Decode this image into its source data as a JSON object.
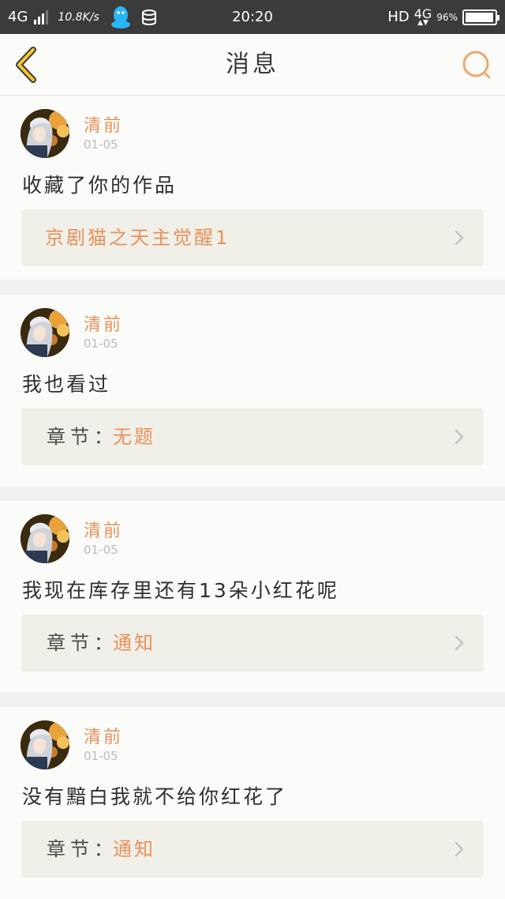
{
  "status_bar": {
    "network": "4G",
    "speed": "10.8K/s",
    "time": "20:20",
    "hd": "HD",
    "network_right": "4G",
    "battery_percent": "96%",
    "battery_level": 0.96,
    "icons": [
      "signal-icon",
      "qq-icon",
      "database-icon",
      "battery-icon"
    ]
  },
  "header": {
    "title": "消息",
    "back_icon": "chevron-left-icon",
    "search_icon": "search-icon",
    "accent_color": "#f0a86c"
  },
  "messages": [
    {
      "user": "清前",
      "date": "01-05",
      "text": "收藏了你的作品",
      "ref_label": "",
      "ref_value": "京剧猫之天主觉醒1"
    },
    {
      "user": "清前",
      "date": "01-05",
      "text": "我也看过",
      "ref_label": "章节：",
      "ref_value": "无题"
    },
    {
      "user": "清前",
      "date": "01-05",
      "text": "我现在库存里还有13朵小红花呢",
      "ref_label": "章节：",
      "ref_value": "通知"
    },
    {
      "user": "清前",
      "date": "01-05",
      "text": "没有黯白我就不给你红花了",
      "ref_label": "章节：",
      "ref_value": "通知"
    }
  ],
  "colors": {
    "name": "#e8915a",
    "ref_value": "#e8915a",
    "ref_box": "#f0efe8"
  }
}
